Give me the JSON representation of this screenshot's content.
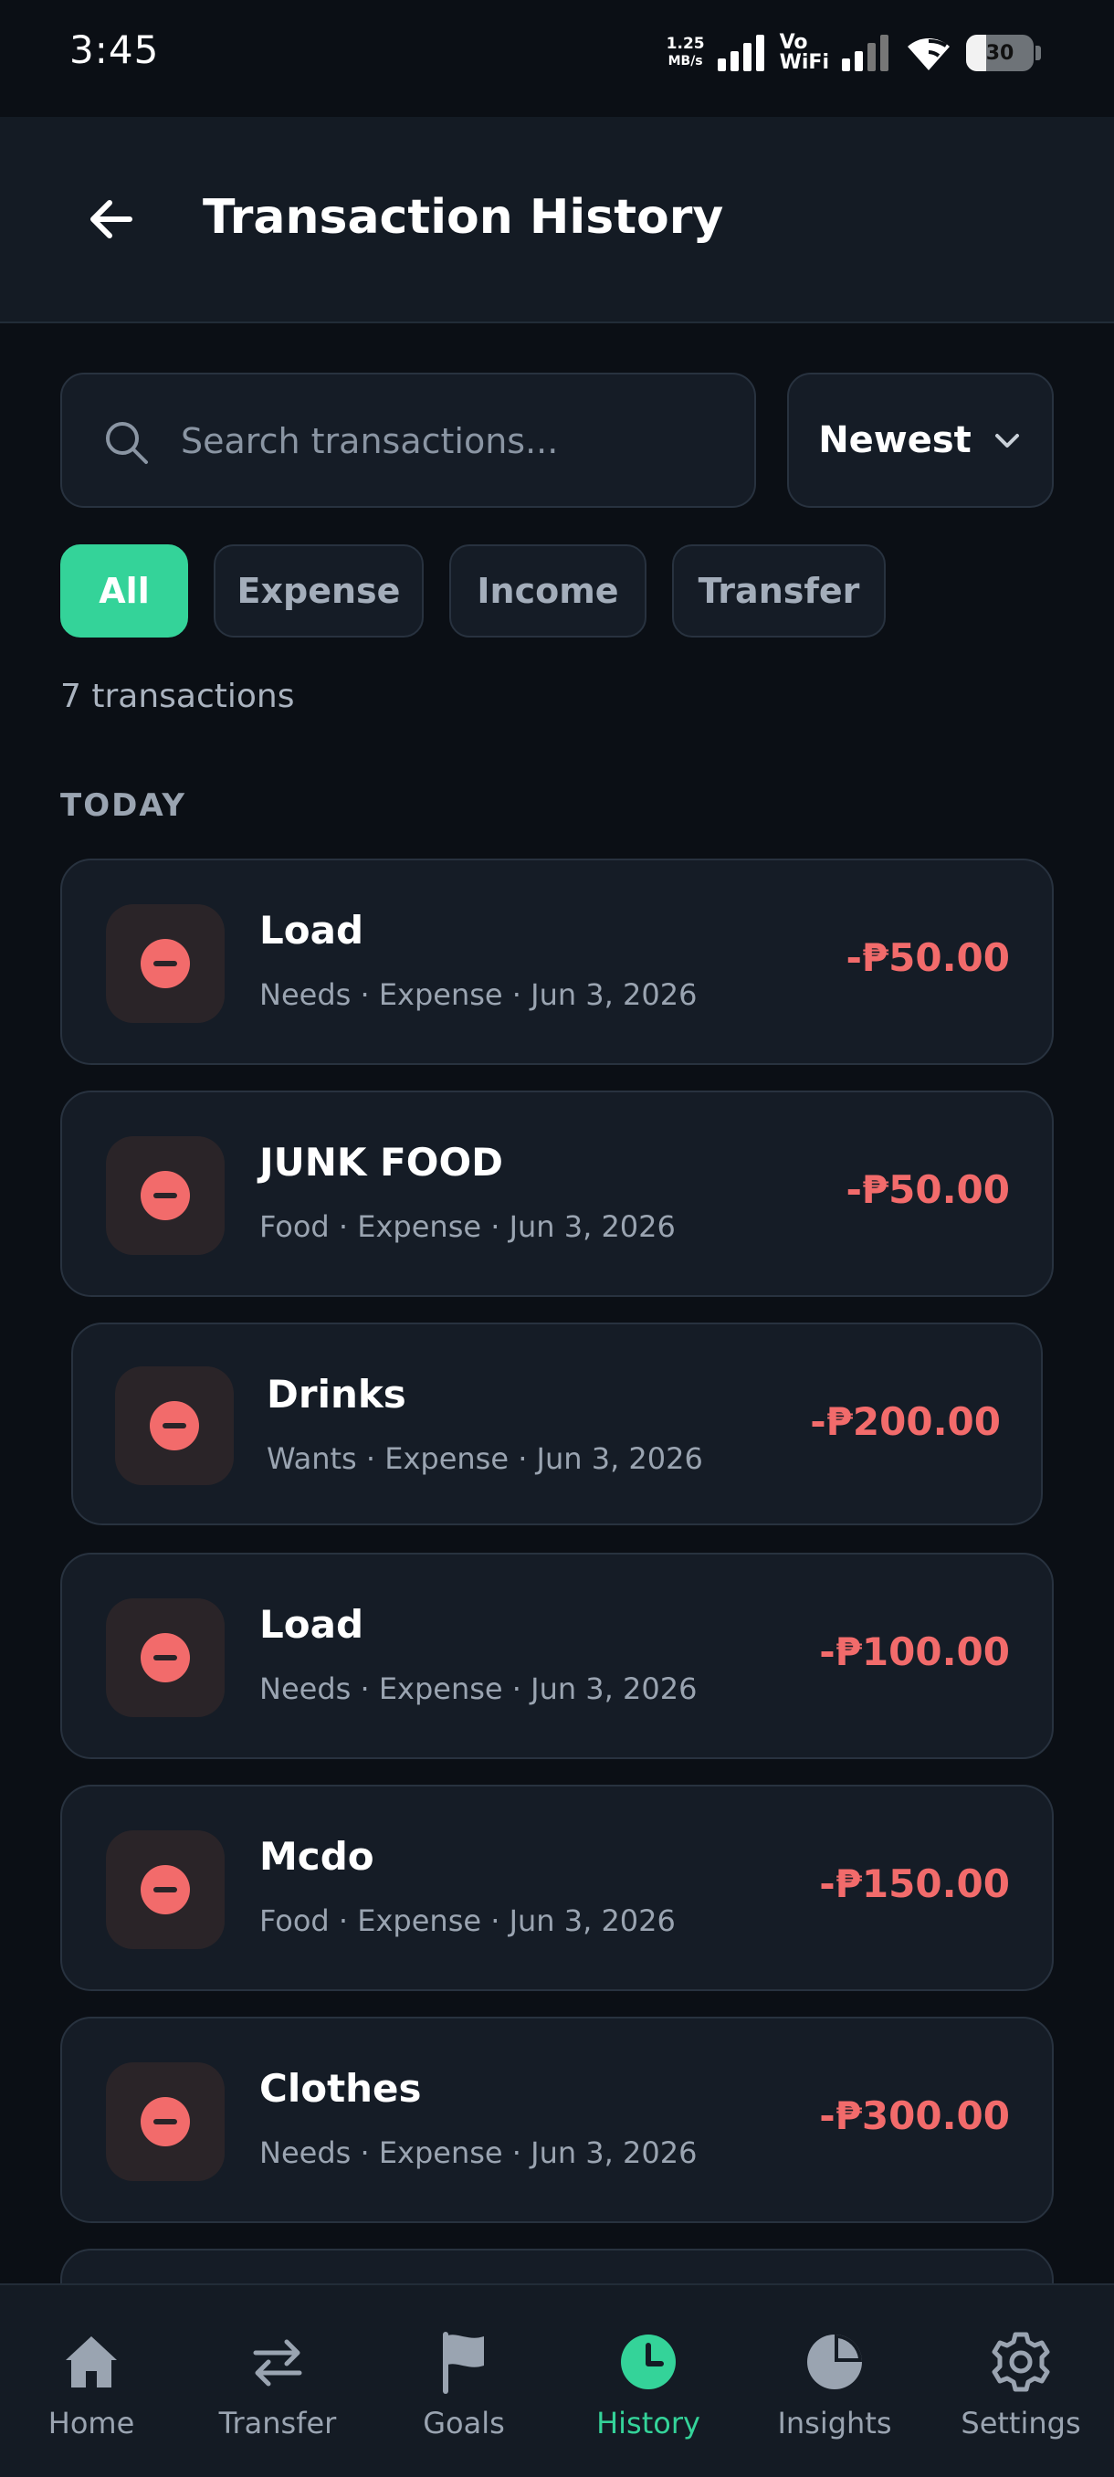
{
  "status_bar": {
    "time": "3:45",
    "net_speed_value": "1.25",
    "net_speed_unit": "MB/s",
    "vowifi_line1": "Vo",
    "vowifi_line2": "WiFi",
    "battery": "30"
  },
  "header": {
    "title": "Transaction History"
  },
  "search": {
    "placeholder": "Search transactions...",
    "value": ""
  },
  "sort": {
    "selected": "Newest"
  },
  "filters": [
    {
      "label": "All",
      "active": true
    },
    {
      "label": "Expense",
      "active": false
    },
    {
      "label": "Income",
      "active": false
    },
    {
      "label": "Transfer",
      "active": false
    }
  ],
  "summary": {
    "count_text": "7 transactions"
  },
  "sections": [
    {
      "label": "TODAY",
      "transactions": [
        {
          "title": "Load",
          "meta": "Needs · Expense · Jun 3, 2026",
          "amount": "-₱50.00"
        },
        {
          "title": "JUNK FOOD",
          "meta": "Food · Expense · Jun 3, 2026",
          "amount": "-₱50.00"
        },
        {
          "title": "Drinks",
          "meta": "Wants · Expense · Jun 3, 2026",
          "amount": "-₱200.00"
        },
        {
          "title": "Load",
          "meta": "Needs · Expense · Jun 3, 2026",
          "amount": "-₱100.00"
        },
        {
          "title": "Mcdo",
          "meta": "Food · Expense · Jun 3, 2026",
          "amount": "-₱150.00"
        },
        {
          "title": "Clothes",
          "meta": "Needs · Expense · Jun 3, 2026",
          "amount": "-₱300.00"
        }
      ]
    }
  ],
  "colors": {
    "accent": "#34d399",
    "expense": "#f26b6b",
    "background": "#0b0f15",
    "card": "#151c26"
  },
  "bottom_nav": [
    {
      "label": "Home",
      "icon": "home-icon",
      "active": false
    },
    {
      "label": "Transfer",
      "icon": "transfer-icon",
      "active": false
    },
    {
      "label": "Goals",
      "icon": "flag-icon",
      "active": false
    },
    {
      "label": "History",
      "icon": "clock-icon",
      "active": true
    },
    {
      "label": "Insights",
      "icon": "pie-chart-icon",
      "active": false
    },
    {
      "label": "Settings",
      "icon": "gear-icon",
      "active": false
    }
  ]
}
